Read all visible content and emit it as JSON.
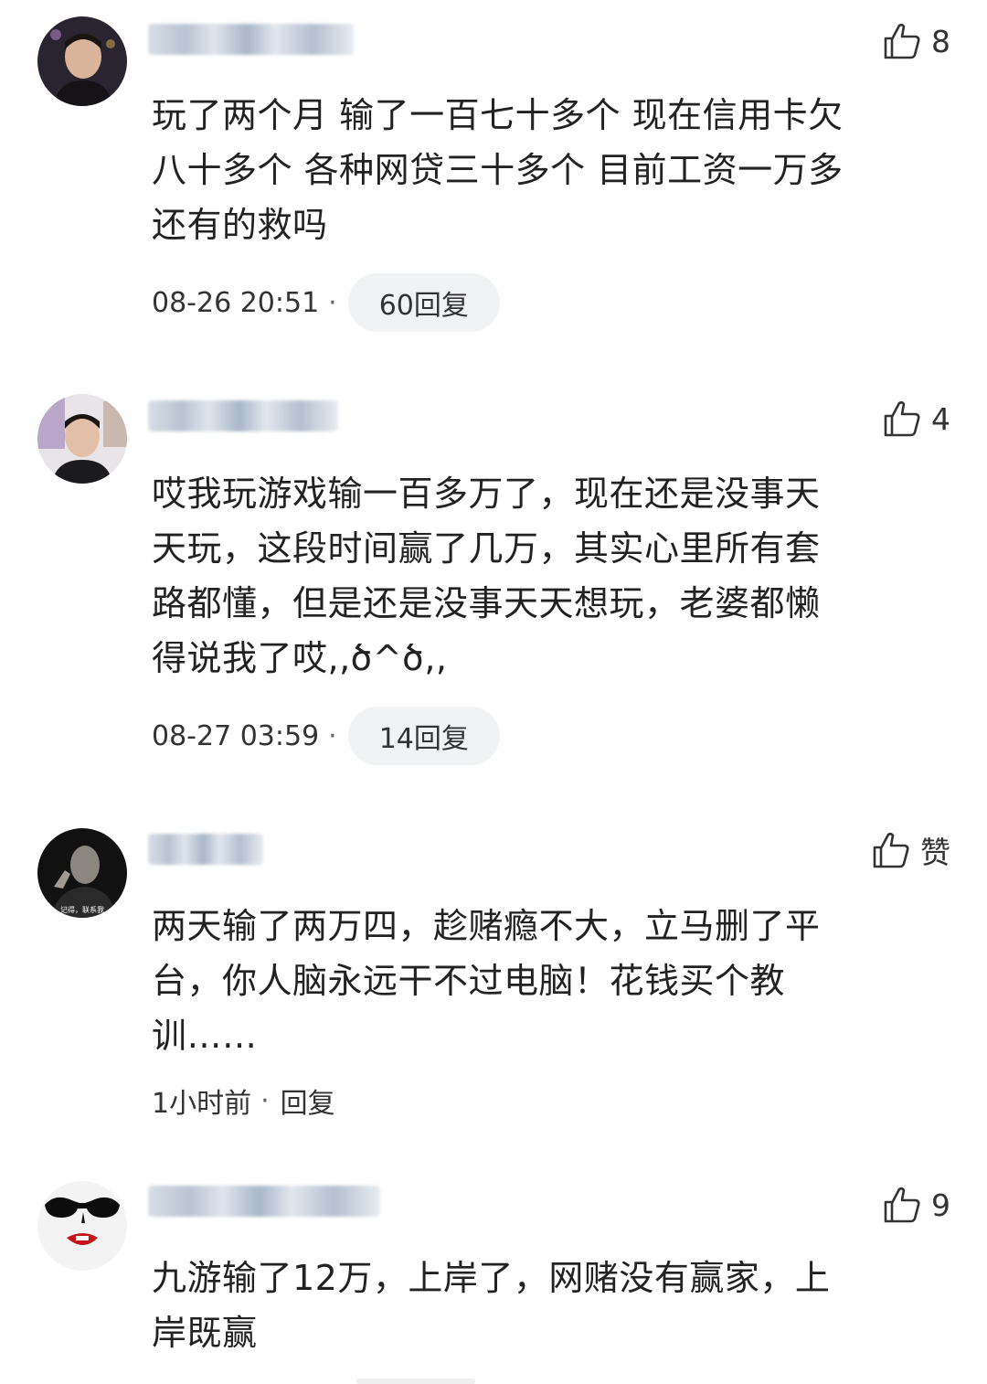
{
  "comments": [
    {
      "like_count": "8",
      "text": "玩了两个月 输了一百七十多个 现在信用卡欠\n八十多个 各种网贷三十多个 目前工资一万多\n还有的救吗",
      "time": "08-26 20:51",
      "replies": "60回复"
    },
    {
      "like_count": "4",
      "text": "哎我玩游戏输一百多万了，现在还是没事天\n天玩，这段时间赢了几万，其实心里所有套\n路都懂，但是还是没事天天想玩，老婆都懒\n得说我了哎,,ծ^ծ,,",
      "time": "08-27 03:59",
      "replies": "14回复"
    },
    {
      "like_count": "赞",
      "avatar_caption": "记得，联系我",
      "text": "两天输了两万四，趁赌瘾不大，立马删了平\n台，你人脑永远干不过电脑！花钱买个教\n训……",
      "time": "1小时前",
      "replies": "回复"
    },
    {
      "like_count": "9",
      "text": "九游输了12万，上岸了，网赌没有赢家，上\n岸既赢"
    }
  ],
  "separator": "·",
  "icons": {
    "like": "thumbs-up-icon"
  }
}
